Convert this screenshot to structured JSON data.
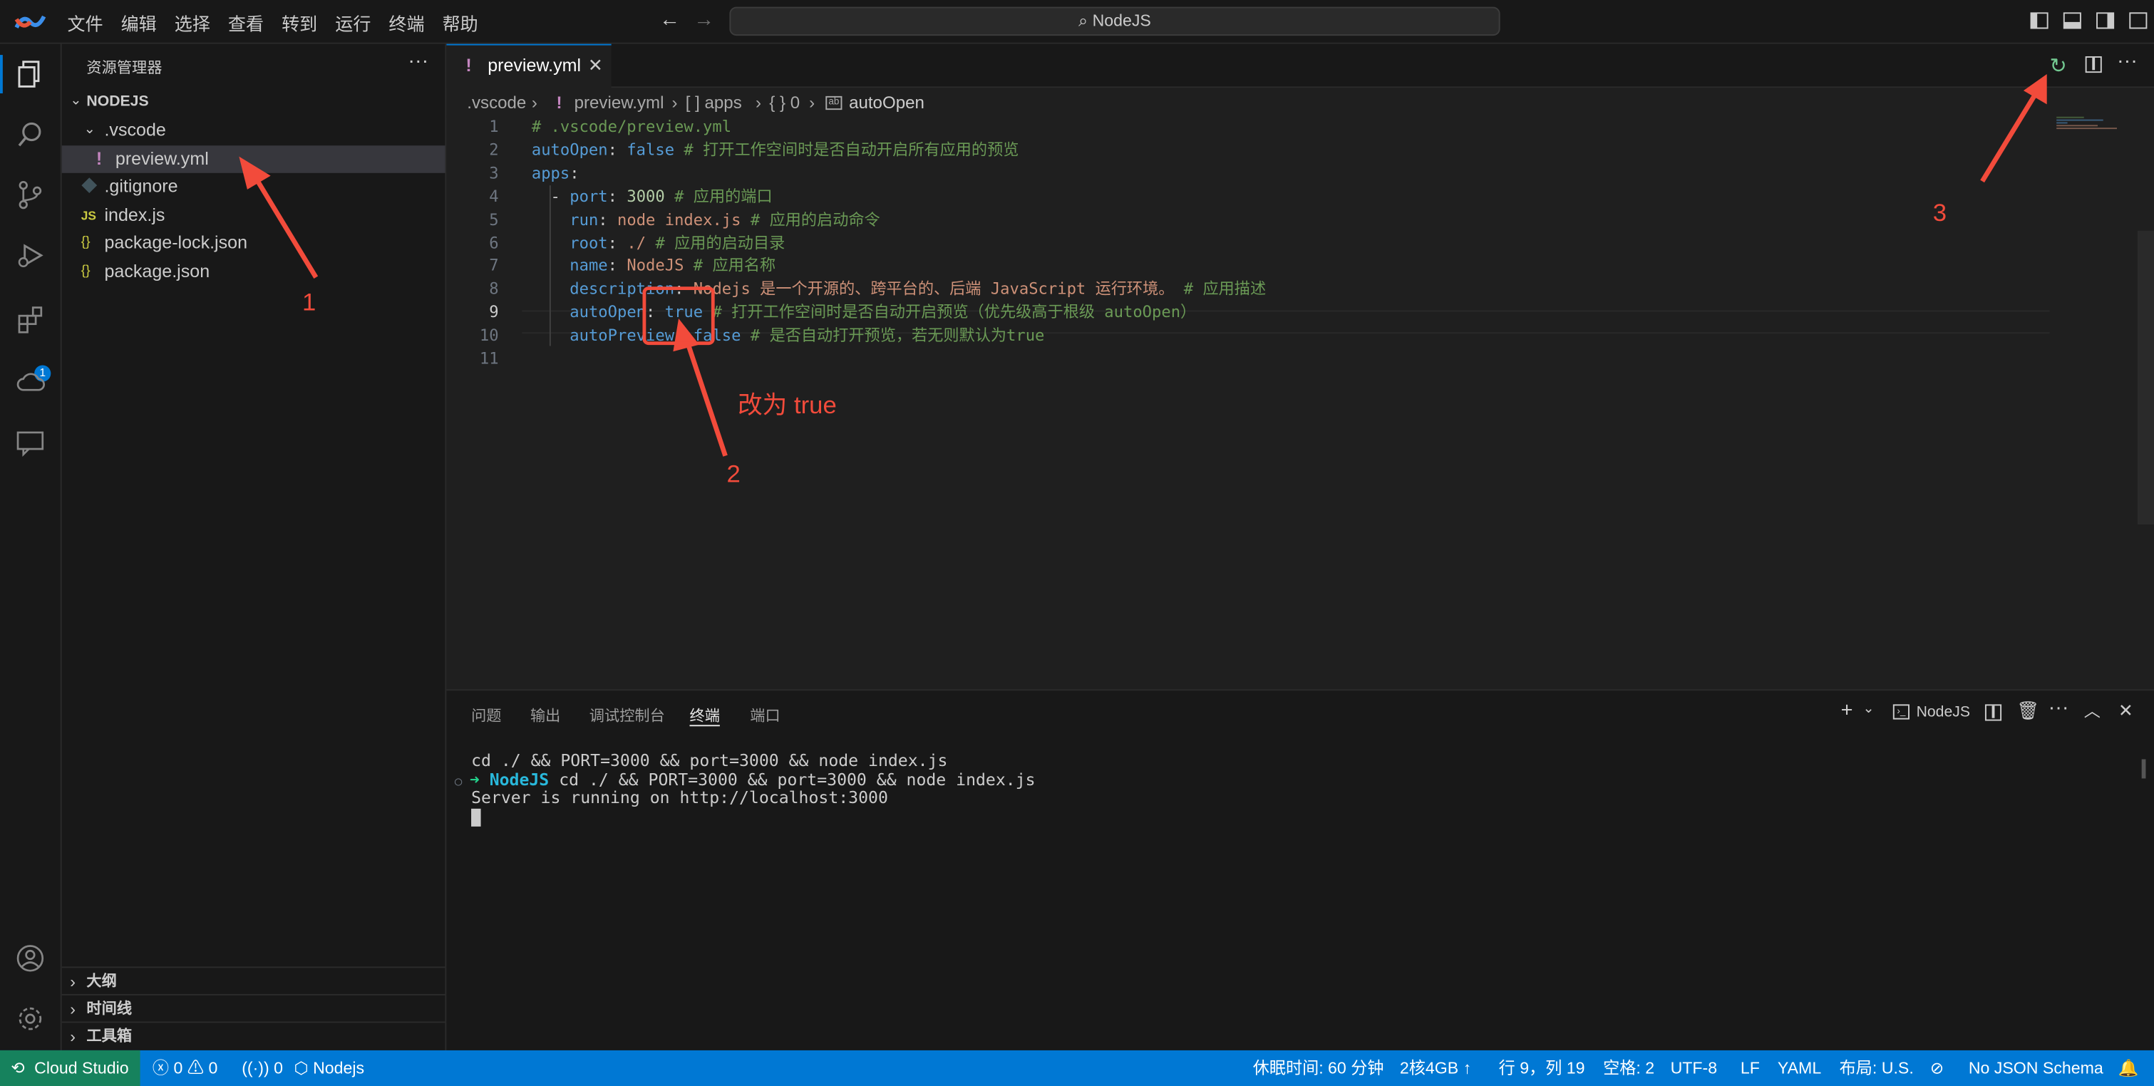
{
  "menu": [
    "文件",
    "编辑",
    "选择",
    "查看",
    "转到",
    "运行",
    "终端",
    "帮助"
  ],
  "search": {
    "text": "NodeJS"
  },
  "sidebar": {
    "title": "资源管理器",
    "root": "NODEJS",
    "items": [
      {
        "label": ".vscode",
        "icon": "chevron-down-icon"
      },
      {
        "label": "preview.yml",
        "icon": "!"
      },
      {
        "label": ".gitignore",
        "icon": "git-icon"
      },
      {
        "label": "index.js",
        "icon": "JS"
      },
      {
        "label": "package-lock.json",
        "icon": "{}"
      },
      {
        "label": "package.json",
        "icon": "{}"
      }
    ],
    "sections": [
      "大纲",
      "时间线",
      "工具箱"
    ]
  },
  "editor": {
    "tab_label": "preview.yml",
    "tab_icon": "!",
    "breadcrumb": [
      ".vscode",
      "preview.yml",
      "[ ] apps",
      "{ } 0",
      "autoOpen"
    ],
    "lines": [
      "1",
      "2",
      "3",
      "4",
      "5",
      "6",
      "7",
      "8",
      "9",
      "10",
      "11"
    ],
    "code": {
      "l1": "# .vscode/preview.yml",
      "l2_key": "autoOpen",
      "l2_val": "false",
      "l2_comment": "# 打开工作空间时是否自动开启所有应用的预览",
      "l3_key": "apps",
      "l4_key": "port",
      "l4_val": "3000",
      "l4_comment": "# 应用的端口",
      "l5_key": "run",
      "l5_val": "node index.js",
      "l5_comment": "# 应用的启动命令",
      "l6_key": "root",
      "l6_val": "./",
      "l6_comment": "# 应用的启动目录",
      "l7_key": "name",
      "l7_val": "NodeJS",
      "l7_comment": "# 应用名称",
      "l8_key": "description",
      "l8_val": "Nodejs 是一个开源的、跨平台的、后端 JavaScript 运行环境。",
      "l8_comment": "# 应用描述",
      "l9_key": "autoOpen",
      "l9_val": "true",
      "l9_comment": "# 打开工作空间时是否自动开启预览（优先级高于根级 autoOpen）",
      "l10_key": "autoPreview",
      "l10_val": "false",
      "l10_comment": "# 是否自动打开预览，若无则默认为true"
    }
  },
  "annotations": {
    "a1": "1",
    "a2": "2",
    "a3": "3",
    "note": "改为 true",
    "accent": "#f24b3b"
  },
  "panel": {
    "tabs": [
      "问题",
      "输出",
      "调试控制台",
      "终端",
      "端口"
    ],
    "active_tab": "终端",
    "terminal_name": "NodeJS",
    "lines": {
      "l1": "cd ./ && PORT=3000 && port=3000 && node index.js",
      "prompt_dir": "NodeJS",
      "l2": "cd ./ && PORT=3000 && port=3000 && node index.js",
      "l3": "Server is running on http://localhost:3000"
    }
  },
  "status": {
    "remote": "Cloud Studio",
    "errors": "0",
    "warnings": "0",
    "ports": "0",
    "env": "Nodejs",
    "sleep": "休眠时间: 60 分钟",
    "spec": "2核4GB",
    "position": "行 9，列 19",
    "spaces": "空格: 2",
    "encoding": "UTF-8",
    "eol": "LF",
    "lang": "YAML",
    "layout": "布局: U.S.",
    "schema": "No JSON Schema"
  },
  "colors": {
    "accent": "#0078d4",
    "status_bg": "#0078d4",
    "remote_bg": "#16825d"
  }
}
